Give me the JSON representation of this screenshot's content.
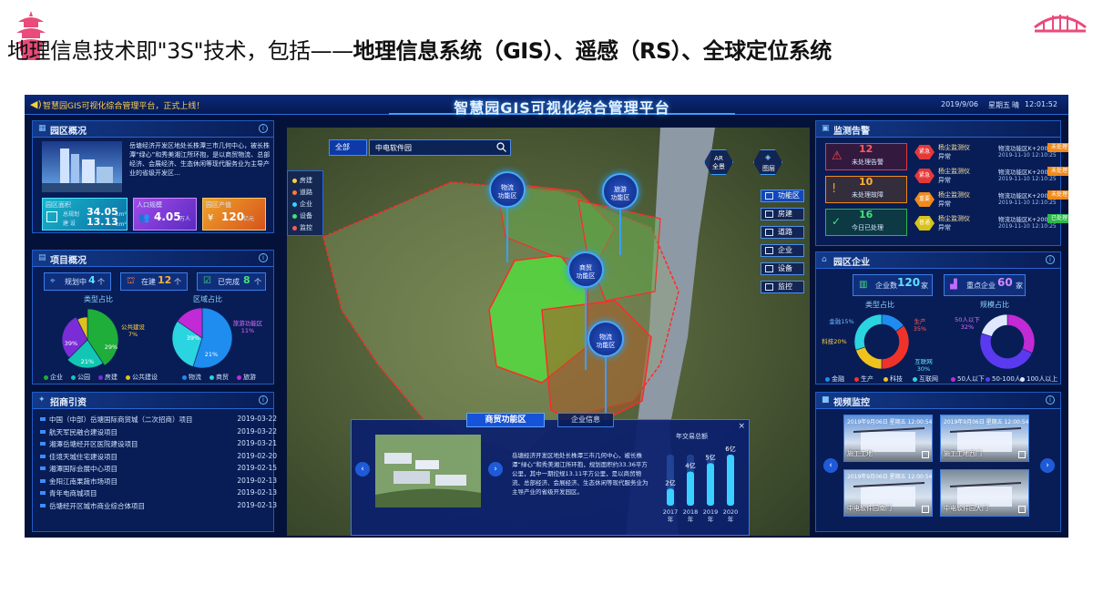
{
  "slide": {
    "title_plain": "地理信息技术即\"3S\"技术，包括——",
    "title_bold": "地理信息系统（GIS）、遥感（RS）、全球定位系统"
  },
  "dashboard": {
    "ticker": "智慧园GIS可视化综合管理平台，正式上线！",
    "title": "智慧园GIS可视化综合管理平台",
    "date": "2019/9/06",
    "weekday": "星期五",
    "weather": "晴",
    "time": "12:01:52"
  },
  "overview": {
    "title": "园区概况",
    "description": "岳塘经济开发区地处长株潭三市几何中心，被长株潭“绿心”和秀美湘江所环抱，是以商贸物流、总部经济、会展经济、生态休闲等现代服务业为主导产业的省级开发区…",
    "area_label": "园区面积",
    "area_total_label": "总规划",
    "area_total_value": "34.05",
    "area_built_label": "建 设",
    "area_built_value": "13.13",
    "unit_km2": "km²",
    "population_label": "人口规模",
    "population_value": "4.05",
    "population_unit": "万人",
    "output_label": "园区产值",
    "output_value": "120",
    "output_unit": "亿元"
  },
  "projects": {
    "title": "项目概况",
    "planning_label": "规划中",
    "planning_value": "4",
    "ongoing_label": "在建",
    "ongoing_value": "12",
    "done_label": "已完成",
    "done_value": "8",
    "unit": "个",
    "type_title": "类型占比",
    "region_title": "区域占比"
  },
  "investment": {
    "title": "招商引资",
    "rows": [
      {
        "name": "中国（中部）岳塘国际商贸城（二次招商）项目",
        "date": "2019-03-22"
      },
      {
        "name": "航天军民融合建设项目",
        "date": "2019-03-22"
      },
      {
        "name": "湘潭岳塘经开区医院建设项目",
        "date": "2019-03-21"
      },
      {
        "name": "佳境天城住宅建设项目",
        "date": "2019-02-20"
      },
      {
        "name": "湘潭国际会展中心项目",
        "date": "2019-02-15"
      },
      {
        "name": "金阳江南果蔬市场项目",
        "date": "2019-02-13"
      },
      {
        "name": "青年电商城项目",
        "date": "2019-02-13"
      },
      {
        "name": "岳塘经开区城市商业综合体项目",
        "date": "2019-02-13"
      }
    ]
  },
  "map": {
    "search_scope": "全部",
    "search_value": "中电软件园",
    "legend": [
      {
        "label": "房建",
        "color": "#ffcf3a"
      },
      {
        "label": "道路",
        "color": "#ff7a3a"
      },
      {
        "label": "企业",
        "color": "#3ad0ff"
      },
      {
        "label": "设备",
        "color": "#45e07a"
      },
      {
        "label": "监控",
        "color": "#ff5a5a"
      }
    ],
    "ar_label": "AR\n全景",
    "layer_label": "图层",
    "tools": [
      "功能区",
      "房建",
      "道路",
      "企业",
      "设备",
      "监控"
    ],
    "pins": [
      {
        "l1": "物流",
        "l2": "功能区"
      },
      {
        "l1": "旅游",
        "l2": "功能区"
      },
      {
        "l1": "商贸",
        "l2": "功能区"
      },
      {
        "l1": "物流",
        "l2": "功能区"
      }
    ]
  },
  "popup": {
    "tab_active": "商贸功能区",
    "tab_other": "企业信息",
    "description": "岳塘经济开发区地处长株潭三市几何中心，被长株潭“绿心”和秀美湘江所环抱，规划面积约33.36平方公里，其中一期控规13.11平方公里，是以商贸物流、总部经济、会展经济、生态休闲等现代服务业为主导产业的省级开发园区。",
    "chart_title": "年交易总额",
    "close": "×"
  },
  "alerts": {
    "title": "监测告警",
    "unhandled_label": "未处理告警",
    "unhandled_value": "12",
    "fault_label": "未处理故障",
    "fault_value": "10",
    "handled_label": "今日已处理",
    "handled_value": "16",
    "rows": [
      {
        "level": "紧急",
        "level_color": "#e53939",
        "device": "杨尘监测仪",
        "state": "异常",
        "place": "物流功能区K+200",
        "time": "2019-11-10 12:10:25",
        "status": "未处理",
        "status_color": "#f08a1c"
      },
      {
        "level": "紧急",
        "level_color": "#e53939",
        "device": "杨尘监测仪",
        "state": "异常",
        "place": "物流功能区K+200",
        "time": "2019-11-10 12:10:25",
        "status": "未处理",
        "status_color": "#f08a1c"
      },
      {
        "level": "重要",
        "level_color": "#f08a1c",
        "device": "杨尘监测仪",
        "state": "异常",
        "place": "物流功能区K+200",
        "time": "2019-11-10 12:10:25",
        "status": "未处理",
        "status_color": "#f08a1c"
      },
      {
        "level": "普通",
        "level_color": "#d8c21c",
        "device": "杨尘监测仪",
        "state": "异常",
        "place": "物流功能区K+200",
        "time": "2019-11-10 12:10:25",
        "status": "已处理",
        "status_color": "#2cb84a"
      }
    ]
  },
  "enterprise": {
    "title": "园区企业",
    "count_label": "企业数",
    "count_value": "120",
    "key_label": "重点企业",
    "key_value": "60",
    "unit": "家",
    "type_title": "类型占比",
    "scale_title": "规模占比"
  },
  "video": {
    "title": "视频监控",
    "cams": [
      {
        "label": "施工工地",
        "stamp": "2019年9月06日 星期五 12:00:54"
      },
      {
        "label": "施工工地西门",
        "stamp": "2019年9月06日 星期五 12:00:54"
      },
      {
        "label": "中电软件园南门",
        "stamp": "2019年9月06日 星期五 12:00:54"
      },
      {
        "label": "中电软件园大门",
        "stamp": ""
      }
    ]
  },
  "chart_data": [
    {
      "type": "pie",
      "title": "类型占比",
      "categories": [
        "企业",
        "公园",
        "房建",
        "公共建设"
      ],
      "values": [
        39,
        21,
        29,
        7
      ],
      "colors": [
        "#1fae3a",
        "#13c6b4",
        "#7a2cd6",
        "#e0c21c"
      ],
      "labels_shown": [
        "39%",
        "21%",
        "29%",
        "公共建设\n7%"
      ]
    },
    {
      "type": "pie",
      "title": "区域占比",
      "categories": [
        "物流",
        "商贸",
        "旅游"
      ],
      "values": [
        39,
        21,
        11
      ],
      "colors": [
        "#1f8cf0",
        "#2ad4e0",
        "#c22ad6"
      ],
      "labels_shown": [
        "39%",
        "21%",
        "旅游功能区\n11%"
      ]
    },
    {
      "type": "bar",
      "title": "年交易总额",
      "categories": [
        "2017\n年",
        "2018\n年",
        "2019\n年",
        "2020\n年"
      ],
      "values": [
        2,
        4,
        5,
        6
      ],
      "value_labels": [
        "2亿",
        "4亿",
        "5亿",
        "6亿"
      ]
    },
    {
      "type": "pie",
      "title": "类型占比",
      "categories": [
        "金融",
        "生产",
        "科技",
        "互联网"
      ],
      "values": [
        15,
        35,
        20,
        30
      ],
      "colors": [
        "#1f8cf0",
        "#f0332a",
        "#f0c21c",
        "#2ad4e0"
      ],
      "labels_shown": [
        "金融15%",
        "生产\n35%",
        "科技20%",
        "互联网\n30%"
      ]
    },
    {
      "type": "pie",
      "title": "规模占比",
      "categories": [
        "50人以下",
        "50-100人",
        "100人以上"
      ],
      "values": [
        32,
        48,
        20
      ],
      "colors": [
        "#c22ad6",
        "#5a3af0",
        "#e0e8ff"
      ],
      "labels_shown": [
        "50人以下\n32%"
      ]
    }
  ]
}
